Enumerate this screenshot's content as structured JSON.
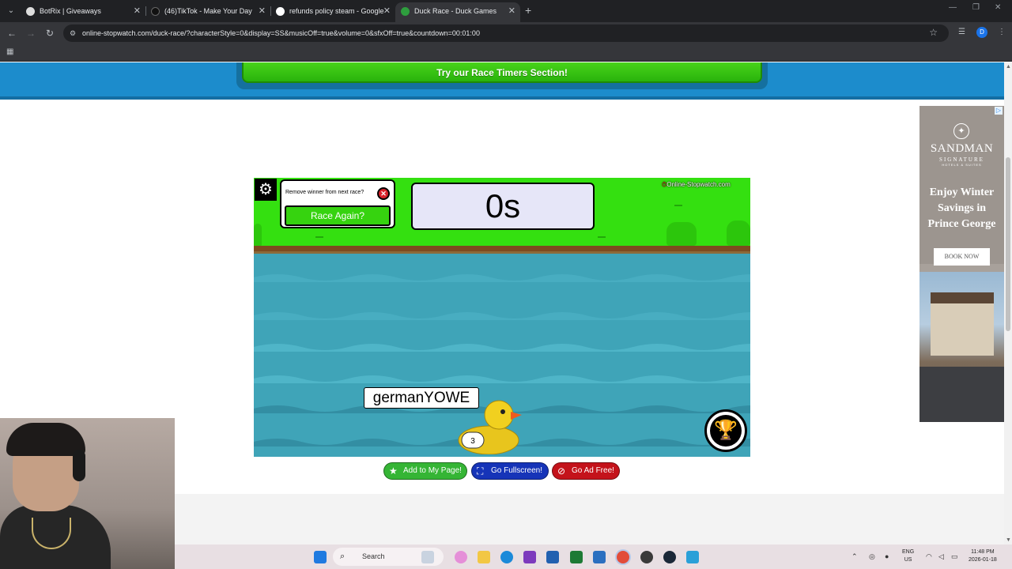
{
  "browser": {
    "tabs": [
      {
        "title": "BotRix | Giveaways",
        "active": false
      },
      {
        "title": "(46)TikTok - Make Your Day",
        "active": false
      },
      {
        "title": "refunds policy steam - Google",
        "active": false
      },
      {
        "title": "Duck Race - Duck Games",
        "active": true
      }
    ],
    "url": "online-stopwatch.com/duck-race/?characterStyle=0&display=SS&musicOff=true&volume=0&sfxOff=true&countdown=00:01:00",
    "profile_initial": "D"
  },
  "page": {
    "race_timers_button": "Try our Race Timers Section!",
    "game": {
      "remove_winner_label": "Remove winner from next race?",
      "race_again_label": "Race Again?",
      "timer_display": "0s",
      "site_logo": "Online-Stopwatch.com",
      "duck_name": "germanYOWE",
      "duck_number": "3"
    },
    "buttons": {
      "add_to_page": "Add to My Page!",
      "fullscreen": "Go Fullscreen!",
      "ad_free": "Go Ad Free!"
    }
  },
  "ad": {
    "brand": "SANDMAN",
    "subbrand": "SIGNATURE",
    "tagline": "HOTELS & SUITES",
    "headline": "Enjoy Winter Savings in Prince George",
    "cta": "BOOK NOW"
  },
  "taskbar": {
    "search_placeholder": "Search",
    "lang_line1": "ENG",
    "lang_line2": "US",
    "time": "11:48 PM",
    "date": "2026-01-18"
  },
  "colors": {
    "accent_green": "#36d30f",
    "band_blue": "#1c8ccc",
    "water": "#3fa4b8"
  }
}
